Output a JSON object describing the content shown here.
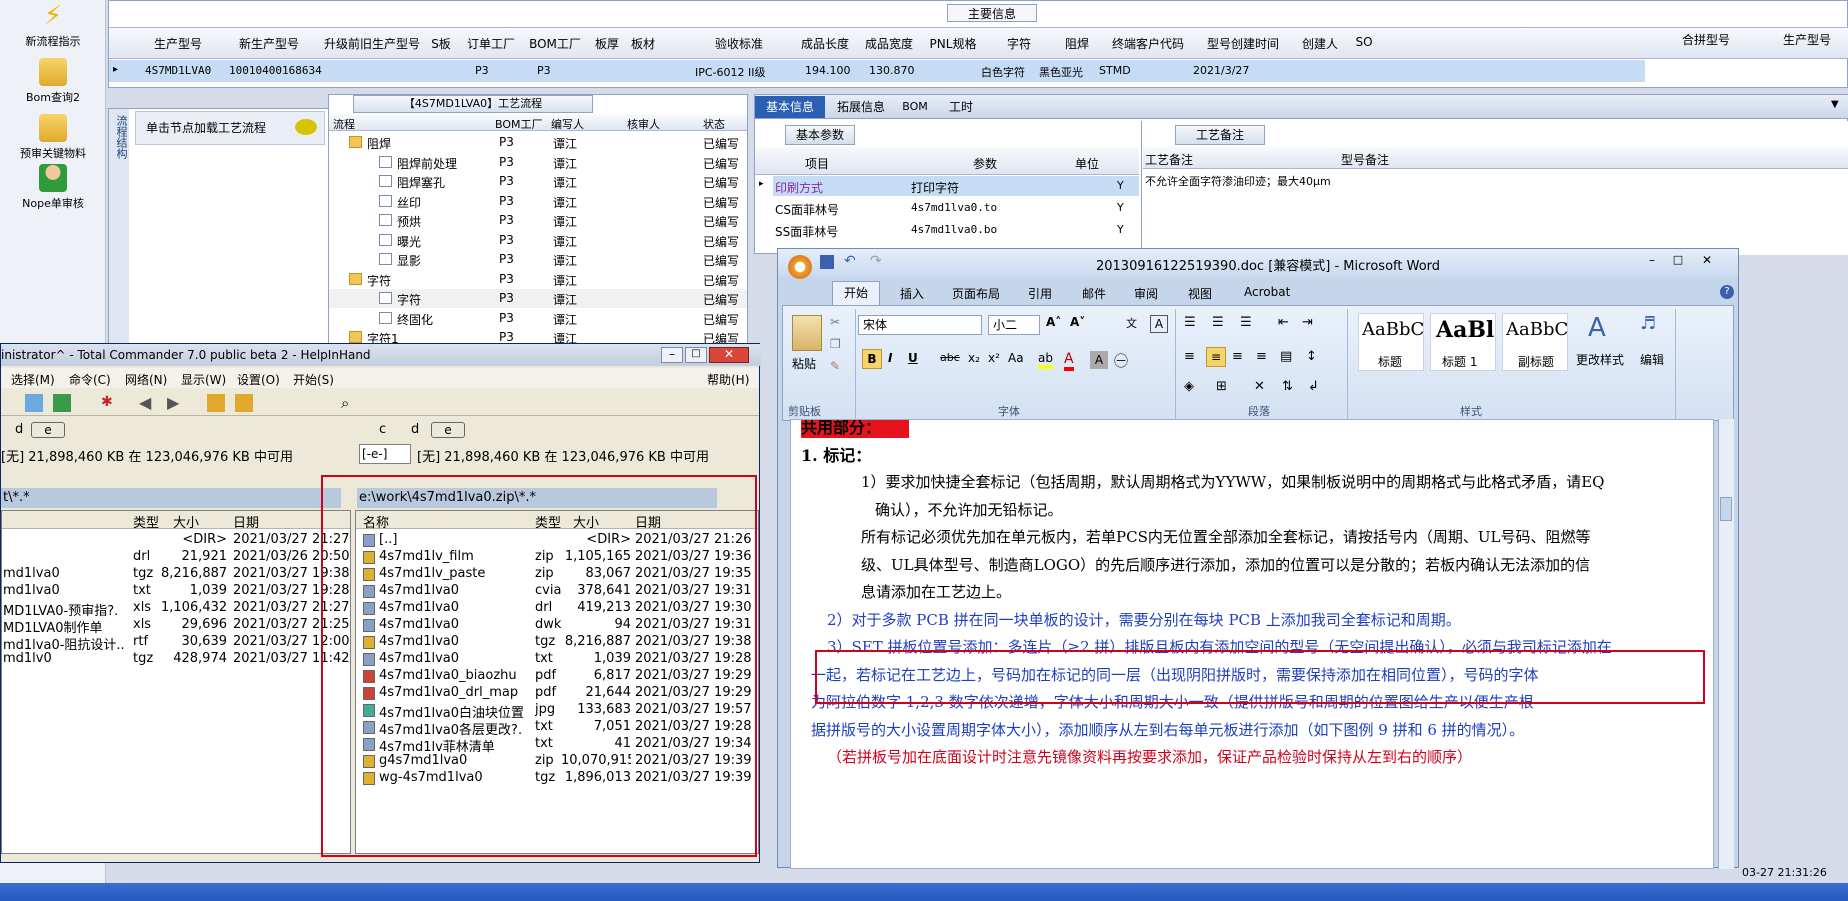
{
  "left_bar": {
    "items": [
      {
        "label": "新流程指示",
        "icon": "lightning-icon"
      },
      {
        "label": "Bom查询2",
        "icon": "folder-icon"
      },
      {
        "label": "预审关键物料",
        "icon": "folder-icon"
      },
      {
        "label": "Nope单审核",
        "icon": "user-icon"
      }
    ]
  },
  "top_grid": {
    "group_title": "主要信息",
    "columns": [
      "生产型号",
      "新生产型号",
      "升级前旧生产型号",
      "S板",
      "订单工厂",
      "BOM工厂",
      "板厚",
      "板材",
      "验收标准",
      "成品长度",
      "成品宽度",
      "PNL规格",
      "字符",
      "阻焊",
      "终端客户代码",
      "型号创建时间",
      "创建人",
      "SO"
    ],
    "right_columns": [
      "合拼型号",
      "生产型号"
    ],
    "row": [
      "4S7MD1LVA0",
      "10010400168634",
      "",
      "",
      "P3",
      "P3",
      "",
      "",
      "IPC-6012 II级",
      "194.100",
      "130.870",
      "",
      "白色字符",
      "黑色亚光",
      "STMD",
      "2021/3/27",
      "",
      ""
    ]
  },
  "process_panel": {
    "title": "【4S7MD1LVA0】工艺流程",
    "columns": [
      "流程",
      "BOM工厂",
      "编写人",
      "核审人",
      "状态"
    ],
    "rows": [
      {
        "name": "阻焊",
        "factory": "P3",
        "writer": "谭江",
        "status": "已编写",
        "level": 1,
        "folder": true
      },
      {
        "name": "阻焊前处理",
        "factory": "P3",
        "writer": "谭江",
        "status": "已编写",
        "level": 2
      },
      {
        "name": "阻焊塞孔",
        "factory": "P3",
        "writer": "谭江",
        "status": "已编写",
        "level": 2
      },
      {
        "name": "丝印",
        "factory": "P3",
        "writer": "谭江",
        "status": "已编写",
        "level": 2
      },
      {
        "name": "预烘",
        "factory": "P3",
        "writer": "谭江",
        "status": "已编写",
        "level": 2
      },
      {
        "name": "曝光",
        "factory": "P3",
        "writer": "谭江",
        "status": "已编写",
        "level": 2
      },
      {
        "name": "显影",
        "factory": "P3",
        "writer": "谭江",
        "status": "已编写",
        "level": 2
      },
      {
        "name": "字符",
        "factory": "P3",
        "writer": "谭江",
        "status": "已编写",
        "level": 1,
        "folder": true
      },
      {
        "name": "字符",
        "factory": "P3",
        "writer": "谭江",
        "status": "已编写",
        "level": 2
      },
      {
        "name": "终固化",
        "factory": "P3",
        "writer": "谭江",
        "status": "已编写",
        "level": 2
      },
      {
        "name": "字符1",
        "factory": "P3",
        "writer": "谭江",
        "status": "已编写",
        "level": 1,
        "folder": true
      }
    ]
  },
  "left_panel": {
    "side_tab": "流程结构",
    "hint": "单击节点加载工艺流程"
  },
  "info_panel": {
    "tabs": [
      "基本信息",
      "拓展信息",
      "BOM",
      "工时"
    ],
    "subtab": "基本参数",
    "columns": [
      "项目",
      "参数",
      "单位"
    ],
    "rows": [
      {
        "item": "印刷方式",
        "param": "打印字符",
        "unit": "",
        "flag": "Y"
      },
      {
        "item": "CS面菲林号",
        "param": "4s7md1lva0.to",
        "unit": "",
        "flag": "Y"
      },
      {
        "item": "SS面菲林号",
        "param": "4s7md1lva0.bo",
        "unit": "",
        "flag": "Y"
      }
    ],
    "remarks_tab": "工艺备注",
    "remarks_cols": [
      "工艺备注",
      "型号备注"
    ],
    "remark_text": "不允许全面字符渗油印迹；最大40μm"
  },
  "total_commander": {
    "title": "inistrator^ - Total Commander 7.0 public beta 2 - HelpInHand",
    "menu": [
      "选择(M)",
      "命令(C)",
      "网络(N)",
      "显示(W)",
      "设置(O)",
      "开始(S)",
      "帮助(H)"
    ],
    "left_drive_info": "[无] 21,898,460 KB 在 123,046,976 KB 中可用",
    "right_drive_info": "[无] 21,898,460 KB 在 123,046,976 KB 中可用",
    "left_path": "t\\*.*",
    "right_path": "e:\\work\\4s7md1lva0.zip\\*.*",
    "drive_letters": [
      "d",
      "c",
      "d",
      "e"
    ],
    "right_drive_select": "[-e-]",
    "cols": [
      "名称",
      "类型",
      "大小",
      "日期"
    ],
    "left_files": [
      {
        "name": "",
        "type": "",
        "size": "<DIR>",
        "date": "2021/03/27 21:27"
      },
      {
        "name": "",
        "type": "drl",
        "size": "21,921",
        "date": "2021/03/26 20:50"
      },
      {
        "name": "md1lva0",
        "type": "tgz",
        "size": "8,216,887",
        "date": "2021/03/27 19:38"
      },
      {
        "name": "md1lva0",
        "type": "txt",
        "size": "1,039",
        "date": "2021/03/27 19:28"
      },
      {
        "name": "MD1LVA0-预审指?.",
        "type": "xls",
        "size": "1,106,432",
        "date": "2021/03/27 21:27"
      },
      {
        "name": "MD1LVA0制作单",
        "type": "xls",
        "size": "29,696",
        "date": "2021/03/27 21:25"
      },
      {
        "name": "md1lva0-阻抗设计..",
        "type": "rtf",
        "size": "30,639",
        "date": "2021/03/27 12:00"
      },
      {
        "name": "md1lv0",
        "type": "tgz",
        "size": "428,974",
        "date": "2021/03/27 11:42"
      }
    ],
    "right_files": [
      {
        "name": "[..]",
        "type": "",
        "size": "<DIR>",
        "date": "2021/03/27 21:26"
      },
      {
        "name": "4s7md1lv_film",
        "type": "zip",
        "size": "1,105,165",
        "date": "2021/03/27 19:36"
      },
      {
        "name": "4s7md1lv_paste",
        "type": "zip",
        "size": "83,067",
        "date": "2021/03/27 19:35"
      },
      {
        "name": "4s7md1lva0",
        "type": "cvia",
        "size": "378,641",
        "date": "2021/03/27 19:31"
      },
      {
        "name": "4s7md1lva0",
        "type": "drl",
        "size": "419,213",
        "date": "2021/03/27 19:30"
      },
      {
        "name": "4s7md1lva0",
        "type": "dwk",
        "size": "94",
        "date": "2021/03/27 19:31"
      },
      {
        "name": "4s7md1lva0",
        "type": "tgz",
        "size": "8,216,887",
        "date": "2021/03/27 19:38"
      },
      {
        "name": "4s7md1lva0",
        "type": "txt",
        "size": "1,039",
        "date": "2021/03/27 19:28"
      },
      {
        "name": "4s7md1lva0_biaozhu",
        "type": "pdf",
        "size": "6,817",
        "date": "2021/03/27 19:29"
      },
      {
        "name": "4s7md1lva0_drl_map",
        "type": "pdf",
        "size": "21,644",
        "date": "2021/03/27 19:29"
      },
      {
        "name": "4s7md1lva0白油块位置",
        "type": "jpg",
        "size": "133,683",
        "date": "2021/03/27 19:57"
      },
      {
        "name": "4s7md1lva0各层更改?.",
        "type": "txt",
        "size": "7,051",
        "date": "2021/03/27 19:28"
      },
      {
        "name": "4s7md1lv菲林清单",
        "type": "txt",
        "size": "41",
        "date": "2021/03/27 19:34"
      },
      {
        "name": "g4s7md1lva0",
        "type": "zip",
        "size": "10,070,915",
        "date": "2021/03/27 19:39"
      },
      {
        "name": "wg-4s7md1lva0",
        "type": "tgz",
        "size": "1,896,013",
        "date": "2021/03/27 19:39"
      }
    ]
  },
  "word": {
    "title": "20130916122519390.doc [兼容模式] - Microsoft Word",
    "tabs": [
      "开始",
      "插入",
      "页面布局",
      "引用",
      "邮件",
      "审阅",
      "视图",
      "Acrobat"
    ],
    "font_name": "宋体",
    "font_size": "小二",
    "group_labels": [
      "剪贴板",
      "字体",
      "段落",
      "样式"
    ],
    "paste_label": "粘贴",
    "styles": [
      {
        "preview": "AaBbC",
        "label": "标题"
      },
      {
        "preview": "AaBl",
        "label": "标题 1"
      },
      {
        "preview": "AaBbC",
        "label": "副标题"
      }
    ],
    "change_style": "更改样式",
    "edit": "编辑",
    "doc_lines": [
      {
        "text": "共用部分：",
        "color": "#000000"
      },
      {
        "text": "1.   标记：",
        "color": "#000000"
      },
      {
        "text": "1）要求加快捷全套标记（包括周期，默认周期格式为YYWW，如果制板说明中的周期格式与此格式矛盾，请EQ",
        "color": "#000000"
      },
      {
        "text": "确认），不允许加无铅标记。",
        "color": "#000000"
      },
      {
        "text": "所有标记必须优先加在单元板内，若单PCS内无位置全部添加全套标记，请按括号内（周期、UL号码、阻燃等",
        "color": "#000000"
      },
      {
        "text": "级、UL具体型号、制造商LOGO）的先后顺序进行添加，添加的位置可以是分散的；若板内确认无法添加的信",
        "color": "#000000"
      },
      {
        "text": "息请添加在工艺边上。",
        "color": "#000000"
      },
      {
        "text": "2）对于多款 PCB 拼在同一块单板的设计，需要分别在每块 PCB 上添加我司全套标记和周期。",
        "color": "#1f3fbf"
      },
      {
        "text": "3）SET 拼板位置号添加：多连片（≥2 拼）排版且板内有添加空间的型号（无空间提出确认），必须与我司标记添加在",
        "color": "#1f3fbf"
      },
      {
        "text": "一起，若标记在工艺边上，号码加在标记的同一层（出现阴阳拼版时，需要保持添加在相同位置），号码的字体",
        "color": "#1f3fbf"
      },
      {
        "text": "为阿拉伯数字  1,2,3  数字依次递增，字体大小和周期大小一致（提供拼版号和周期的位置图给生产以便生产根",
        "color": "#1f3fbf"
      },
      {
        "text": "据拼版号的大小设置周期字体大小），添加顺序从左到右每单元板进行添加（如下图例 9 拼和 6 拼的情况）。",
        "color": "#1f3fbf"
      },
      {
        "text": "（若拼板号加在底面设计时注意先镜像资料再按要求添加，保证产品检验时保持从左到右的顺序）",
        "color": "#d0021b"
      }
    ]
  },
  "status_time": "03-27 21:31:26",
  "colors": {
    "accent": "#2b5fb4",
    "red_box": "#d0021b",
    "doc_blue": "#1f3fbf",
    "doc_red": "#d0021b"
  }
}
